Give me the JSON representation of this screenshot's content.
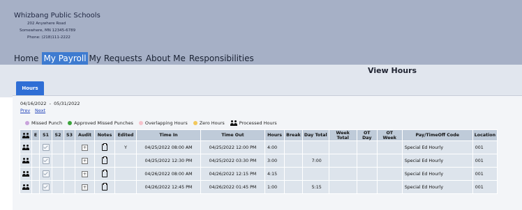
{
  "header": {
    "org_name": "Whizbang Public Schools",
    "address_line1": "202 Anywhere Road",
    "address_line2": "Somewhere, MN 12345-6789",
    "phone": "Phone: (218)111-2222"
  },
  "nav": {
    "items": [
      "Home",
      "My Payroll",
      "My Requests",
      "About Me",
      "Responsibilities"
    ],
    "active": "My Payroll"
  },
  "page": {
    "title": "View Hours",
    "tab_label": "Hours",
    "date_range": "04/16/2022  -  05/31/2022",
    "prev_label": "Prev",
    "next_label": "Next"
  },
  "legend": [
    {
      "label": "Missed Punch",
      "color": "#c9a3dc"
    },
    {
      "label": "Approved Missed Punches",
      "color": "#3aa33a"
    },
    {
      "label": "Overlapping Hours",
      "color": "#f6c3cc"
    },
    {
      "label": "Zero Hours",
      "color": "#f2c85c"
    },
    {
      "label": "Processed Hours",
      "icon": "users-icon"
    }
  ],
  "table": {
    "headers": [
      "",
      "E",
      "S1",
      "S2",
      "S3",
      "Audit",
      "Notes",
      "Edited",
      "Time In",
      "Time Out",
      "Hours",
      "Break",
      "Day Total",
      "Week Total",
      "OT Day",
      "OT Week",
      "Pay/TimeOff Code",
      "Location"
    ],
    "rows": [
      {
        "edited": "Y",
        "time_in": "04/25/2022 08:00 AM",
        "time_out": "04/25/2022 12:00 PM",
        "hours": "4:00",
        "break": "",
        "day_total": "",
        "week_total": "",
        "ot_day": "",
        "ot_week": "",
        "code": "Special Ed Hourly",
        "location": "001"
      },
      {
        "edited": "",
        "time_in": "04/25/2022 12:30 PM",
        "time_out": "04/25/2022 03:30 PM",
        "hours": "3:00",
        "break": "",
        "day_total": "7:00",
        "week_total": "",
        "ot_day": "",
        "ot_week": "",
        "code": "Special Ed Hourly",
        "location": "001"
      },
      {
        "edited": "",
        "time_in": "04/26/2022 08:00 AM",
        "time_out": "04/26/2022 12:15 PM",
        "hours": "4:15",
        "break": "",
        "day_total": "",
        "week_total": "",
        "ot_day": "",
        "ot_week": "",
        "code": "Special Ed Hourly",
        "location": "001"
      },
      {
        "edited": "",
        "time_in": "04/26/2022 12:45 PM",
        "time_out": "04/26/2022 01:45 PM",
        "hours": "1:00",
        "break": "",
        "day_total": "5:15",
        "week_total": "",
        "ot_day": "",
        "ot_week": "",
        "code": "Special Ed Hourly",
        "location": "001"
      }
    ]
  }
}
